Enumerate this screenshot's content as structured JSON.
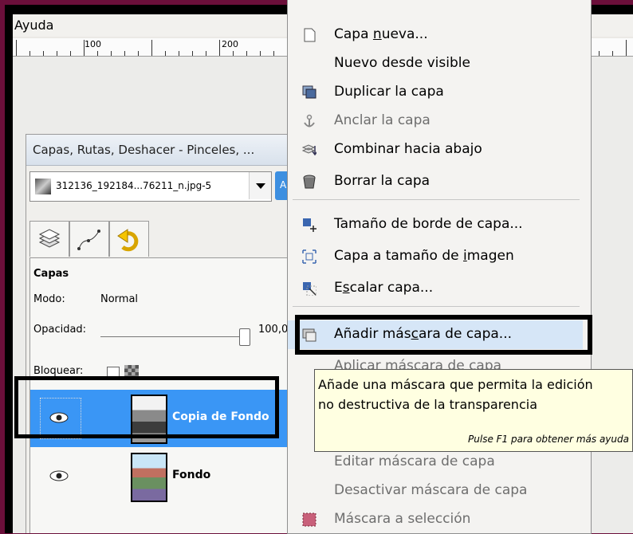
{
  "menubar": {
    "help_label": "Ayuda"
  },
  "ruler": {
    "labels": [
      "100",
      "200"
    ]
  },
  "dock": {
    "title": "Capas, Rutas, Deshacer - Pinceles, ...",
    "image_name": "312136_192184...76211_n.jpg-5",
    "auto_button": "Au",
    "panel_title": "Capas",
    "mode_label": "Modo:",
    "mode_value": "Normal",
    "opacity_label": "Opacidad:",
    "opacity_value": "100,0",
    "lock_label": "Bloquear:",
    "layers": [
      {
        "name": "Copia de Fondo",
        "selected": true
      },
      {
        "name": "Fondo",
        "selected": false
      }
    ]
  },
  "menu": {
    "items": [
      {
        "label": "Capa nueva...",
        "icon": "new-layer-icon",
        "enabled": true
      },
      {
        "label": "Nuevo desde visible",
        "icon": "",
        "enabled": true
      },
      {
        "label": "Duplicar la capa",
        "icon": "duplicate-layer-icon",
        "enabled": true
      },
      {
        "label": "Anclar la capa",
        "icon": "anchor-icon",
        "enabled": false
      },
      {
        "label": "Combinar hacia abajo",
        "icon": "merge-down-icon",
        "enabled": true
      },
      {
        "label": "Borrar la capa",
        "icon": "trash-icon",
        "enabled": true
      },
      {
        "label": "Tamaño de borde de capa...",
        "icon": "layer-boundary-size-icon",
        "enabled": true
      },
      {
        "label": "Capa a tamaño de imagen",
        "icon": "layer-to-image-size-icon",
        "enabled": true
      },
      {
        "label": "Escalar capa...",
        "icon": "scale-layer-icon",
        "enabled": true
      },
      {
        "label": "Añadir máscara de capa...",
        "icon": "add-mask-icon",
        "enabled": true,
        "highlighted": true
      },
      {
        "label": "Aplicar máscara de capa",
        "icon": "",
        "enabled": false
      },
      {
        "label": "Editar máscara de capa",
        "icon": "",
        "enabled": false
      },
      {
        "label": "Desactivar máscara de capa",
        "icon": "",
        "enabled": false
      },
      {
        "label": "Máscara a selección",
        "icon": "mask-to-selection-icon",
        "enabled": false
      }
    ]
  },
  "tooltip": {
    "line1": "Añade una máscara que permita la edición",
    "line2": "no destructiva de la transparencia",
    "hint": "Pulse F1 para obtener más ayuda"
  }
}
